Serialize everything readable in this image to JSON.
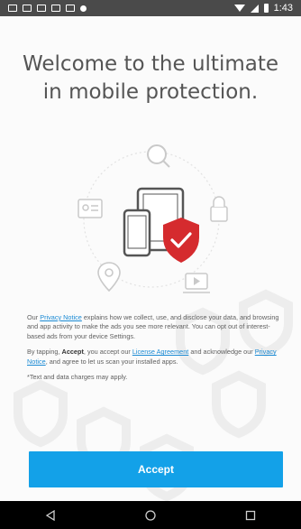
{
  "status_bar": {
    "time": "1:43",
    "left_icons": [
      "notification-icon",
      "mail-icon",
      "mail-icon",
      "image-icon",
      "sd-card-icon",
      "circle-dot-icon"
    ],
    "right_icons": [
      "wifi-icon",
      "signal-icon",
      "battery-icon"
    ]
  },
  "welcome": {
    "headline": "Welcome to the ultimate in mobile protection."
  },
  "legal": {
    "p1_pre": "Our ",
    "p1_link": "Privacy Notice",
    "p1_post": " explains how we collect, use, and disclose your data, and browsing and app activity to make the ads you see more relevant. You can opt out of interest-based ads from your device Settings.",
    "p2_pre": "By tapping, ",
    "p2_bold": "Accept",
    "p2_mid1": ", you accept our ",
    "p2_link1": "License Agreement",
    "p2_mid2": " and acknowledge our ",
    "p2_link2": "Privacy Notice",
    "p2_post": ", and agree to let us scan your installed apps.",
    "p3": "*Text and data charges may apply."
  },
  "accept_button": {
    "label": "Accept"
  },
  "colors": {
    "accent": "#13a1e8",
    "shield_red": "#d52b2e",
    "link": "#1a8ad4"
  },
  "nav": {
    "buttons": [
      "back-icon",
      "home-icon",
      "recents-icon"
    ]
  }
}
